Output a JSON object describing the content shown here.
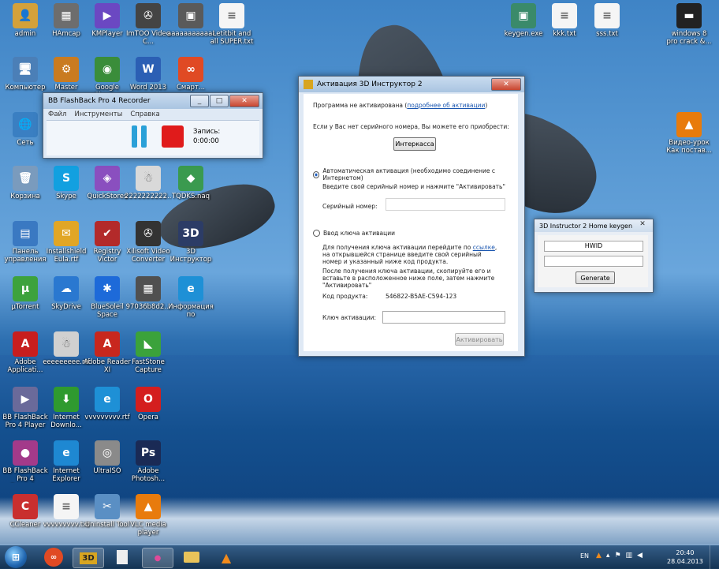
{
  "desktop": {
    "icons": [
      {
        "label": "admin",
        "glyph": "👤",
        "color": "#d4a13a"
      },
      {
        "label": "HAmcap",
        "glyph": "▦",
        "color": "#6d6d6d"
      },
      {
        "label": "KMPlayer",
        "glyph": "▶",
        "color": "#6b48c2"
      },
      {
        "label": "ImTOO Video C...",
        "glyph": "✇",
        "color": "#444"
      },
      {
        "label": "аааааааааааа",
        "glyph": "▣",
        "color": "#5a5a5a"
      },
      {
        "label": "Letitbit and all SUPER.txt",
        "glyph": "≡",
        "color": "#f5f5f5"
      },
      {
        "label": "Компьютер",
        "glyph": "🖥",
        "color": "#4b7fb7"
      },
      {
        "label": "Master",
        "glyph": "⚙",
        "color": "#c97b20"
      },
      {
        "label": "Google Chrome",
        "glyph": "◉",
        "color": "#3a8d3a"
      },
      {
        "label": "Word 2013",
        "glyph": "W",
        "color": "#2b5fb4"
      },
      {
        "label": "Смарт...",
        "glyph": "∞",
        "color": "#e04a24"
      },
      {
        "label": "Сеть",
        "glyph": "🌐",
        "color": "#3a7fc2"
      },
      {
        "label": "Корзина",
        "glyph": "🗑",
        "color": "#7a9bbd"
      },
      {
        "label": "Skype",
        "glyph": "S",
        "color": "#12a0e0"
      },
      {
        "label": "QuickStores",
        "glyph": "◈",
        "color": "#8a4fbf"
      },
      {
        "label": "2222222222...",
        "glyph": "☃",
        "color": "#d9d9d9"
      },
      {
        "label": "TQDKS.naq",
        "glyph": "◆",
        "color": "#3a9a4f"
      },
      {
        "label": "Панель управления",
        "glyph": "▤",
        "color": "#3a79c2"
      },
      {
        "label": "Installshield Eula.rtf",
        "glyph": "✉",
        "color": "#e1a626"
      },
      {
        "label": "Registry Victor",
        "glyph": "✔",
        "color": "#b32a2a"
      },
      {
        "label": "Xilisoft Video Converter",
        "glyph": "✇",
        "color": "#333"
      },
      {
        "label": "3D Инструктор",
        "glyph": "3D",
        "color": "#2c3c66"
      },
      {
        "label": "µTorrent",
        "glyph": "µ",
        "color": "#3da23d"
      },
      {
        "label": "SkyDrive",
        "glyph": "☁",
        "color": "#2a78d0"
      },
      {
        "label": "BlueSoleil Space",
        "glyph": "✱",
        "color": "#1d6ad9"
      },
      {
        "label": "97036b8d2...",
        "glyph": "▦",
        "color": "#505050"
      },
      {
        "label": "Информация по активации",
        "glyph": "e",
        "color": "#1e90d6"
      },
      {
        "label": "Adobe Applicati...",
        "glyph": "A",
        "color": "#c81e1e"
      },
      {
        "label": "eeeeeeeee.rtf",
        "glyph": "☃",
        "color": "#d0d0d0"
      },
      {
        "label": "Adobe Reader XI",
        "glyph": "A",
        "color": "#c8271e"
      },
      {
        "label": "FastStone Capture",
        "glyph": "◣",
        "color": "#3ba23b"
      },
      {
        "label": "BB FlashBack Pro 4 Player",
        "glyph": "▶",
        "color": "#6a6a9a"
      },
      {
        "label": "Internet Downlo...",
        "glyph": "⬇",
        "color": "#2f9a2f"
      },
      {
        "label": "vvvvvvvvv.rtf",
        "glyph": "e",
        "color": "#1e90d6"
      },
      {
        "label": "Opera",
        "glyph": "O",
        "color": "#d41e1e"
      },
      {
        "label": "BB FlashBack Pro 4 Record...",
        "glyph": "●",
        "color": "#a33a8a"
      },
      {
        "label": "Internet Explorer",
        "glyph": "e",
        "color": "#1e88d2"
      },
      {
        "label": "UltraISO",
        "glyph": "◎",
        "color": "#8a8a8a"
      },
      {
        "label": "Adobe Photosh...",
        "glyph": "Ps",
        "color": "#1a2a55"
      },
      {
        "label": "CCleaner",
        "glyph": "C",
        "color": "#c92f2f"
      },
      {
        "label": "vvvvvvvvv.txt",
        "glyph": "≡",
        "color": "#f5f5f5"
      },
      {
        "label": "Uninstall Tool",
        "glyph": "✂",
        "color": "#5a8fc4"
      },
      {
        "label": "VLC media player",
        "glyph": "▲",
        "color": "#e87b0c"
      },
      {
        "label": "keygen.exe",
        "glyph": "▣",
        "color": "#3a8a6a"
      },
      {
        "label": "kkk.txt",
        "glyph": "≡",
        "color": "#f5f5f5"
      },
      {
        "label": "sss.txt",
        "glyph": "≡",
        "color": "#f5f5f5"
      },
      {
        "label": "windows 8 pro crack &...",
        "glyph": "▬",
        "color": "#222"
      },
      {
        "label": "Видео-урок Как постав...",
        "glyph": "▲",
        "color": "#e87b0c"
      }
    ]
  },
  "flashback": {
    "title": "BB FlashBack Pro 4 Recorder",
    "menu": [
      "Файл",
      "Инструменты",
      "Справка"
    ],
    "record_label": "Запись:",
    "record_time": "0:00:00"
  },
  "activation": {
    "title": "Активация 3D Инструктор 2",
    "not_activated": "Программа не активирована (",
    "details_link": "подробнее об активации",
    "not_activated_end": ")",
    "no_serial": "Если у Вас нет серийного номера, Вы можете его приобрести:",
    "interkassa": "Интеркасса",
    "auto_option": "Автоматическая активация (необходимо соединение с Интернетом)",
    "auto_hint": "Введите свой серийный номер и нажмите \"Активировать\"",
    "serial_label": "Серийный номер:",
    "serial_value": "",
    "key_option": "Ввод ключа активации",
    "key_text1a": "Для получения ключа активации перейдите по ",
    "key_link": "ссылке",
    "key_text1b": ", на открывшейся странице введите свой серийный номер и указанный ниже код продукта.",
    "key_text2": "После получения ключа активации, скопируйте его и вставьте в расположенное ниже поле, затем нажмите \"Активировать\"",
    "product_code_label": "Код продукта:",
    "product_code": "546822-B5AE-C594-123",
    "key_label": "Ключ активации:",
    "key_value": "",
    "activate": "Активировать"
  },
  "keygen": {
    "title": "3D Instructor 2 Home keygen",
    "hwid": "HWID",
    "serial": "",
    "generate": "Generate"
  },
  "taskbar": {
    "lang": "EN",
    "time": "20:40",
    "date": "28.04.2013"
  }
}
